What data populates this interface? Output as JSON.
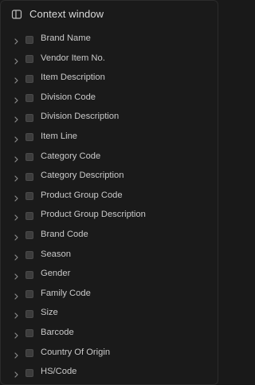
{
  "header": {
    "title": "Context window",
    "icon": "sidebar-panel-icon"
  },
  "fields": [
    {
      "label": "Brand Name",
      "checked": false
    },
    {
      "label": "Vendor Item No.",
      "checked": false
    },
    {
      "label": "Item Description",
      "checked": false
    },
    {
      "label": "Division Code",
      "checked": false
    },
    {
      "label": "Division Description",
      "checked": false
    },
    {
      "label": "Item Line",
      "checked": false
    },
    {
      "label": "Category Code",
      "checked": false
    },
    {
      "label": "Category Description",
      "checked": false
    },
    {
      "label": "Product Group Code",
      "checked": false
    },
    {
      "label": "Product Group Description",
      "checked": false
    },
    {
      "label": "Brand Code",
      "checked": false
    },
    {
      "label": "Season",
      "checked": false
    },
    {
      "label": "Gender",
      "checked": false
    },
    {
      "label": "Family Code",
      "checked": false
    },
    {
      "label": "Size",
      "checked": false
    },
    {
      "label": "Barcode",
      "checked": false
    },
    {
      "label": "Country Of Origin",
      "checked": false
    },
    {
      "label": "HS/Code",
      "checked": false
    }
  ],
  "colors": {
    "background": "#1a1a1a",
    "text": "#c9c9c9",
    "checkbox": "#3c3c3c"
  }
}
